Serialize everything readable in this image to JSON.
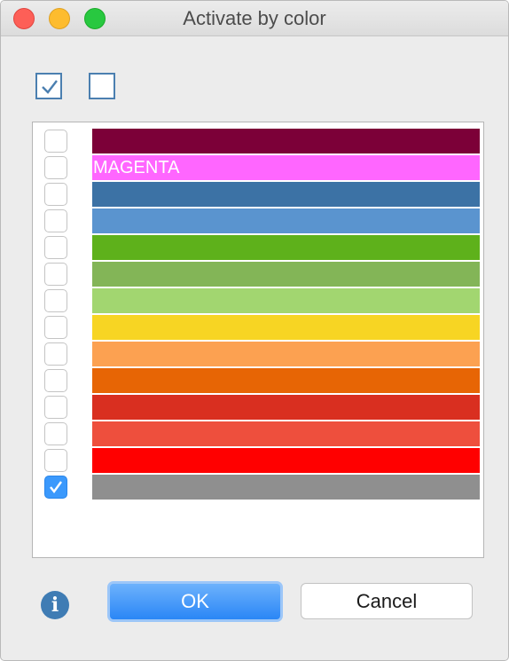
{
  "window": {
    "title": "Activate by color",
    "traffic_lights": [
      "close",
      "minimize",
      "maximize"
    ]
  },
  "toolbar": {
    "select_all": {
      "icon": "checked-box-icon",
      "checked": true
    },
    "select_none": {
      "icon": "unchecked-box-icon",
      "checked": false
    }
  },
  "color_list": [
    {
      "label": "",
      "color": "#7c0038",
      "checked": false
    },
    {
      "label": "MAGENTA",
      "color": "#ff66ff",
      "checked": false
    },
    {
      "label": "",
      "color": "#3c72a5",
      "checked": false
    },
    {
      "label": "",
      "color": "#5a94cf",
      "checked": false
    },
    {
      "label": "",
      "color": "#5eb11b",
      "checked": false
    },
    {
      "label": "",
      "color": "#83b557",
      "checked": false
    },
    {
      "label": "",
      "color": "#a2d670",
      "checked": false
    },
    {
      "label": "",
      "color": "#f7d523",
      "checked": false
    },
    {
      "label": "",
      "color": "#fca151",
      "checked": false
    },
    {
      "label": "",
      "color": "#e76505",
      "checked": false
    },
    {
      "label": "",
      "color": "#d92f20",
      "checked": false
    },
    {
      "label": "",
      "color": "#ee4f3d",
      "checked": false
    },
    {
      "label": "",
      "color": "#ff0000",
      "checked": false
    },
    {
      "label": "",
      "color": "#8f8f8f",
      "checked": true
    }
  ],
  "footer": {
    "info_icon": "info-icon",
    "ok_label": "OK",
    "cancel_label": "Cancel"
  },
  "colors": {
    "accent": "#3b99fc",
    "window_bg": "#ececec"
  }
}
